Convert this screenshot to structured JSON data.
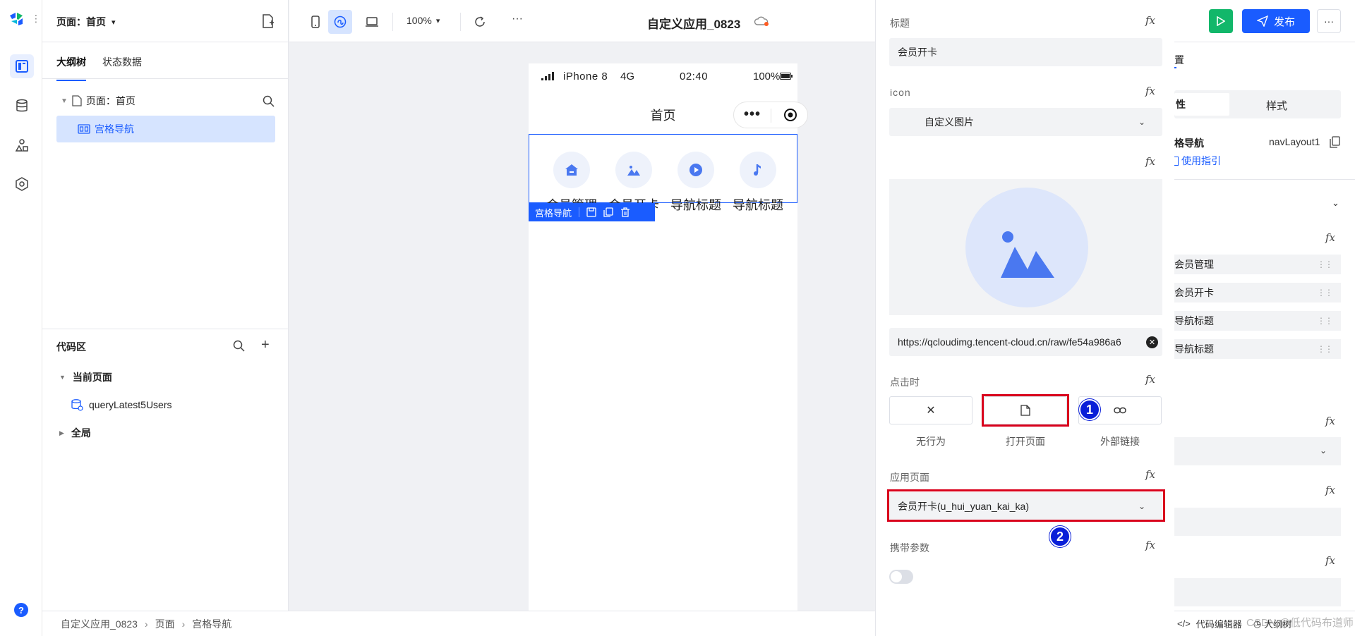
{
  "app": {
    "name": "自定义应用_0823"
  },
  "outline": {
    "page_selector": "页面：首页",
    "tabs": [
      "大纲树",
      "状态数据"
    ],
    "tree_root": "页面：首页",
    "tree_selected": "宫格导航"
  },
  "code_area": {
    "title": "代码区",
    "current_page": "当前页面",
    "query": "queryLatest5Users",
    "global": "全局"
  },
  "toolbar": {
    "zoom": "100%",
    "title": "自定义应用_0823",
    "more": "···"
  },
  "phone": {
    "carrier": "iPhone 8",
    "network": "4G",
    "time": "02:40",
    "battery": "100%",
    "page_title": "首页",
    "nav_items": [
      "会员管理",
      "会员开卡",
      "导航标题",
      "导航标题"
    ],
    "component_tag": "宫格导航"
  },
  "props": {
    "title_label": "标题",
    "title_value": "会员开卡",
    "icon_label": "icon",
    "icon_type": "自定义图片",
    "image_url": "https://qcloudimg.tencent-cloud.cn/raw/fe54a986a6",
    "click_label": "点击时",
    "click_options": [
      "无行为",
      "打开页面",
      "外部链接"
    ],
    "app_page_label": "应用页面",
    "app_page_value": "会员开卡(u_hui_yuan_kai_ka)",
    "carry_params_label": "携带参数",
    "fx": "fx",
    "badges": [
      "1",
      "2"
    ]
  },
  "right_panel": {
    "publish": "发布",
    "tab_partial": "置",
    "tab_left": "性",
    "tab_right": "样式",
    "comp_name": "格导航",
    "comp_id": "navLayout1",
    "guide": "使用指引",
    "items": [
      "会员管理",
      "会员开卡",
      "导航标题",
      "导航标题"
    ],
    "bottom_text": "代码编辑器",
    "bottom_text2": "大纲树"
  },
  "breadcrumb": [
    "自定义应用_0823",
    "页面",
    "宫格导航"
  ],
  "watermark": "CSDN @低代码布道师",
  "colors": {
    "accent": "#1a5cff",
    "highlight": "#d9001b",
    "badge": "#0a1fd8",
    "run": "#12b76a"
  }
}
